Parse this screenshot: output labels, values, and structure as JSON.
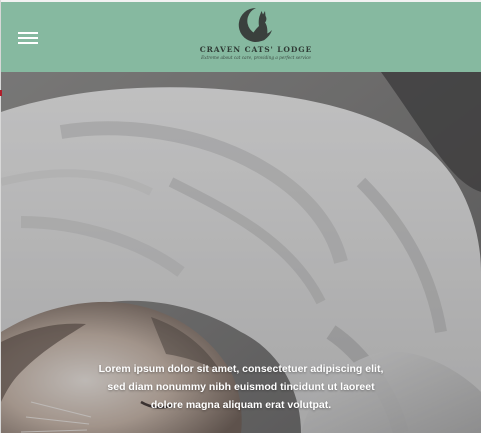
{
  "header": {
    "menu_icon": "hamburger-menu-icon",
    "logo_name": "CRAVEN CATS' LODGE",
    "logo_tagline": "Extreme about cat care, providing a perfect service",
    "logo_icon": "cat-silhouette-icon",
    "background_color": "#86b9a0"
  },
  "hero": {
    "caption": "Lorem ipsum dolor sit amet, consectetuer adipiscing elit, sed diam nonummy nibh euismod tincidunt ut laoreet dolore magna aliquam erat volutpat.",
    "image": "sleeping-cat-under-blanket"
  }
}
